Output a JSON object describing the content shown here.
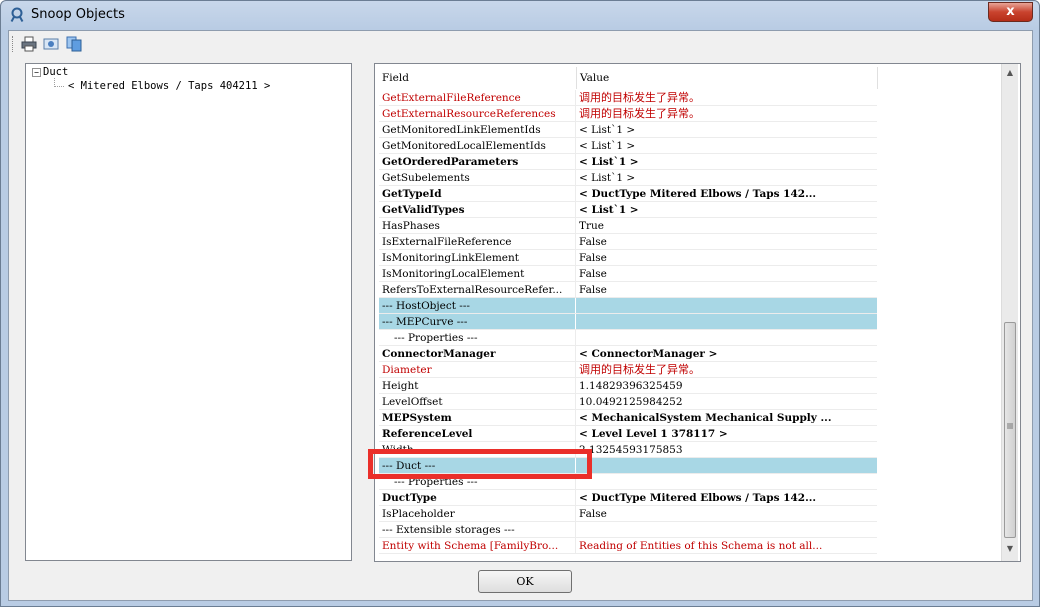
{
  "window": {
    "title": "Snoop Objects",
    "close_label": "x"
  },
  "toolbar": {
    "icons": [
      "print-icon",
      "snapshot-icon",
      "copy-icon"
    ]
  },
  "tree": {
    "expander": "−",
    "root_label": "Duct",
    "child_label": "< Mitered Elbows / Taps  404211 >"
  },
  "grid": {
    "columns": [
      "Field",
      "Value"
    ],
    "rows": [
      {
        "field": "GetExternalFileReference",
        "value": "调用的目标发生了异常。",
        "style": "red",
        "cn": true
      },
      {
        "field": "GetExternalResourceReferences",
        "value": "调用的目标发生了异常。",
        "style": "red",
        "cn": true
      },
      {
        "field": "GetMonitoredLinkElementIds",
        "value": "< List`1 >",
        "style": ""
      },
      {
        "field": "GetMonitoredLocalElementIds",
        "value": "< List`1 >",
        "style": ""
      },
      {
        "field": "GetOrderedParameters",
        "value": "< List`1 >",
        "style": "bold"
      },
      {
        "field": "GetSubelements",
        "value": "< List`1 >",
        "style": ""
      },
      {
        "field": "GetTypeId",
        "value": "< DuctType  Mitered Elbows / Taps  142...",
        "style": "bold"
      },
      {
        "field": "GetValidTypes",
        "value": "< List`1 >",
        "style": "bold"
      },
      {
        "field": "HasPhases",
        "value": "True",
        "style": ""
      },
      {
        "field": "IsExternalFileReference",
        "value": "False",
        "style": ""
      },
      {
        "field": "IsMonitoringLinkElement",
        "value": "False",
        "style": ""
      },
      {
        "field": "IsMonitoringLocalElement",
        "value": "False",
        "style": ""
      },
      {
        "field": "RefersToExternalResourceRefer...",
        "value": "False",
        "style": ""
      },
      {
        "field": "--- HostObject ---",
        "value": "",
        "style": "blue"
      },
      {
        "field": "--- MEPCurve ---",
        "value": "",
        "style": "blue"
      },
      {
        "field": "--- Properties ---",
        "value": "",
        "style": "indent"
      },
      {
        "field": "ConnectorManager",
        "value": "< ConnectorManager >",
        "style": "bold"
      },
      {
        "field": "Diameter",
        "value": "调用的目标发生了异常。",
        "style": "red",
        "cn": true
      },
      {
        "field": "Height",
        "value": "1.14829396325459",
        "style": ""
      },
      {
        "field": "LevelOffset",
        "value": "10.0492125984252",
        "style": ""
      },
      {
        "field": "MEPSystem",
        "value": "< MechanicalSystem  Mechanical Supply ...",
        "style": "bold"
      },
      {
        "field": "ReferenceLevel",
        "value": "< Level  Level 1  378117 >",
        "style": "bold"
      },
      {
        "field": "Width",
        "value": "2.13254593175853",
        "style": ""
      },
      {
        "field": "--- Duct ---",
        "value": "",
        "style": "blue"
      },
      {
        "field": "--- Properties ---",
        "value": "",
        "style": "indent"
      },
      {
        "field": "DuctType",
        "value": "< DuctType  Mitered Elbows / Taps  142...",
        "style": "bold"
      },
      {
        "field": "IsPlaceholder",
        "value": "False",
        "style": ""
      },
      {
        "field": "--- Extensible storages ---",
        "value": "",
        "style": ""
      },
      {
        "field": "Entity with Schema [FamilyBro...",
        "value": "Reading of Entities of this Schema is not all...",
        "style": "red"
      }
    ]
  },
  "buttons": {
    "ok_label": "OK"
  },
  "colors": {
    "highlight": "#ea2f2a",
    "section_row": "#a8d7e5",
    "error_text": "#c00000"
  }
}
